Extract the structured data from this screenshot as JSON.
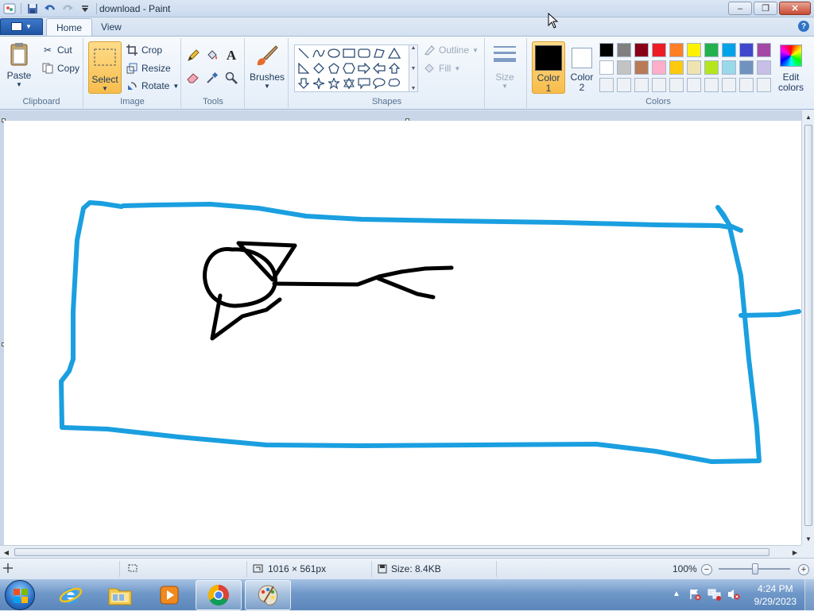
{
  "window": {
    "title": "download - Paint",
    "controls": {
      "minimize": "–",
      "maximize": "❐",
      "close": "✕"
    }
  },
  "tabs": [
    {
      "label": "Home",
      "active": true
    },
    {
      "label": "View",
      "active": false
    }
  ],
  "ribbon": {
    "clipboard": {
      "paste": "Paste",
      "cut": "Cut",
      "copy": "Copy",
      "group": "Clipboard"
    },
    "image": {
      "select": "Select",
      "crop": "Crop",
      "resize": "Resize",
      "rotate": "Rotate",
      "group": "Image"
    },
    "tools": {
      "group": "Tools",
      "text_glyph": "A"
    },
    "brushes": {
      "label": "Brushes"
    },
    "shapes": {
      "group": "Shapes",
      "outline": "Outline",
      "fill": "Fill"
    },
    "size": {
      "label": "Size"
    },
    "colors": {
      "group": "Colors",
      "color1": {
        "line1": "Color",
        "line2": "1",
        "value": "#000000"
      },
      "color2": {
        "line1": "Color",
        "line2": "2",
        "value": "#ffffff"
      },
      "edit": {
        "line1": "Edit",
        "line2": "colors"
      },
      "palette_row1": [
        "#000000",
        "#7f7f7f",
        "#880015",
        "#ed1c24",
        "#ff7f27",
        "#fff200",
        "#22b14c",
        "#00a2e8",
        "#3f48cc",
        "#a349a4"
      ],
      "palette_row2": [
        "#ffffff",
        "#c3c3c3",
        "#b97a57",
        "#ffaec9",
        "#ffc90e",
        "#efe4b0",
        "#b5e61d",
        "#99d9ea",
        "#7092be",
        "#c8bfe7"
      ],
      "palette_row3": [
        "#eef2f7",
        "#eef2f7",
        "#eef2f7",
        "#eef2f7",
        "#eef2f7",
        "#eef2f7",
        "#eef2f7",
        "#eef2f7",
        "#eef2f7",
        "#eef2f7"
      ]
    }
  },
  "drawing": {
    "blue_stroke": "#1a9fe0",
    "black_stroke": "#000000"
  },
  "status": {
    "dimensions": "1016 × 561px",
    "size": "Size: 8.4KB",
    "zoom": "100%"
  },
  "taskbar": {
    "clock_time": "4:24 PM",
    "clock_date": "9/29/2023",
    "apps": [
      "internet-explorer",
      "file-explorer",
      "media-player",
      "chrome",
      "paint"
    ]
  }
}
